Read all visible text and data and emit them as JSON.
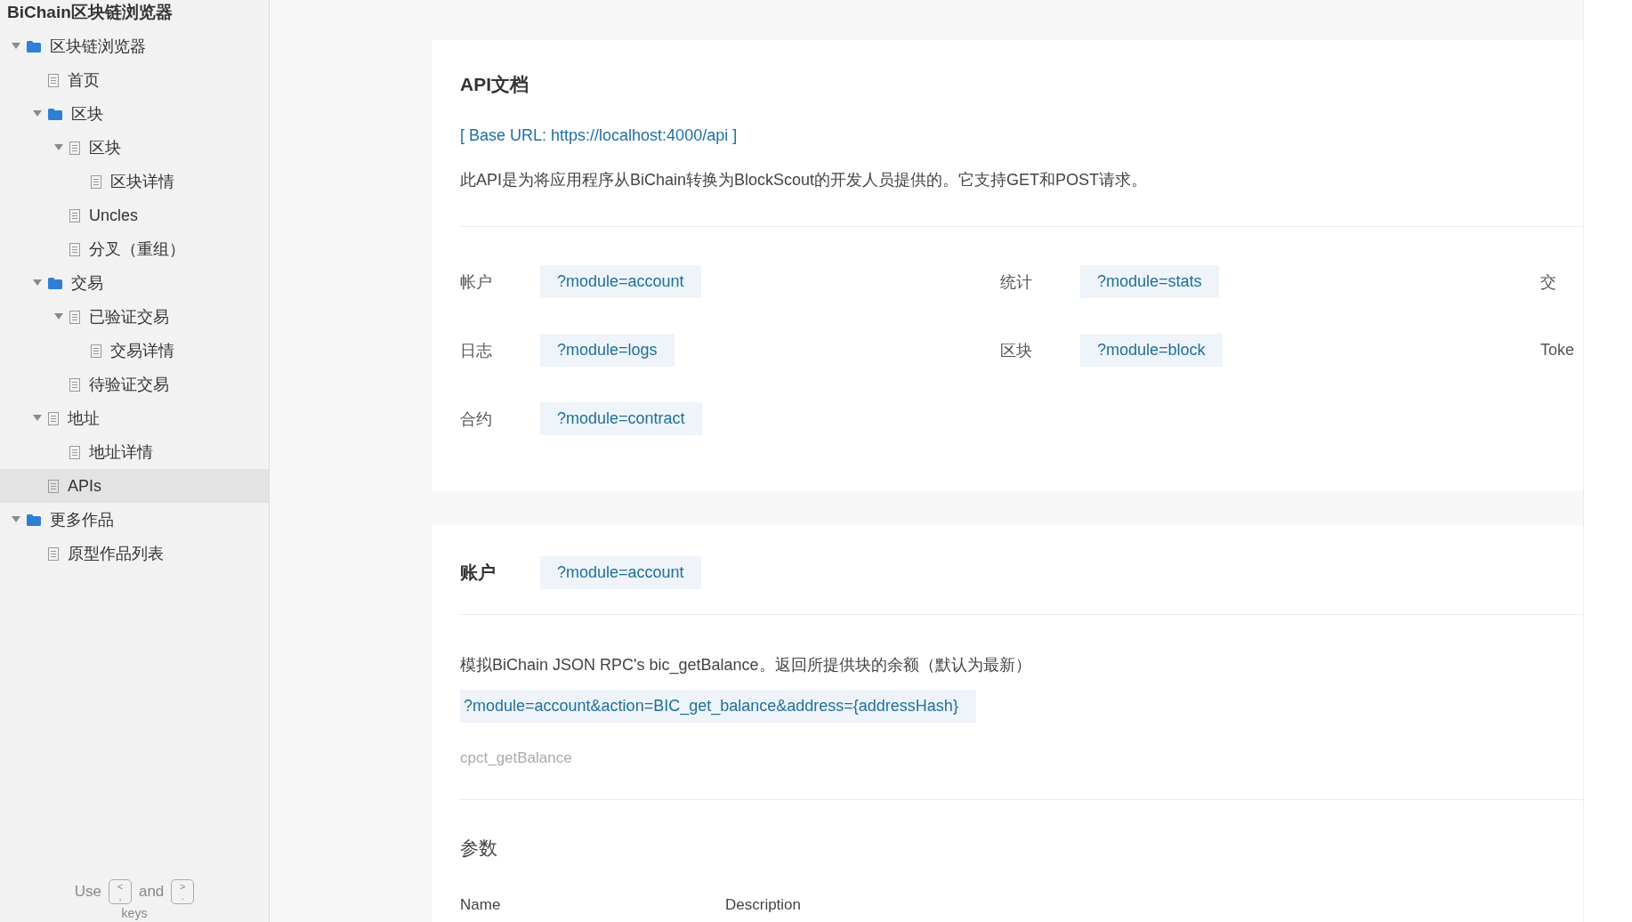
{
  "sidebar": {
    "title": "BiChain区块链浏览器",
    "tree": [
      {
        "label": "区块链浏览器",
        "kind": "folder",
        "expanded": true,
        "selected": false,
        "children": [
          {
            "label": "首页",
            "kind": "page",
            "expanded": false,
            "selected": false
          },
          {
            "label": "区块",
            "kind": "folder",
            "expanded": true,
            "selected": false,
            "children": [
              {
                "label": "区块",
                "kind": "page",
                "expanded": true,
                "selected": false,
                "children": [
                  {
                    "label": "区块详情",
                    "kind": "page",
                    "expanded": false,
                    "selected": false
                  }
                ]
              },
              {
                "label": "Uncles",
                "kind": "page",
                "expanded": false,
                "selected": false
              },
              {
                "label": "分叉（重组）",
                "kind": "page",
                "expanded": false,
                "selected": false
              }
            ]
          },
          {
            "label": "交易",
            "kind": "folder",
            "expanded": true,
            "selected": false,
            "children": [
              {
                "label": "已验证交易",
                "kind": "page",
                "expanded": true,
                "selected": false,
                "children": [
                  {
                    "label": "交易详情",
                    "kind": "page",
                    "expanded": false,
                    "selected": false
                  }
                ]
              },
              {
                "label": "待验证交易",
                "kind": "page",
                "expanded": false,
                "selected": false
              }
            ]
          },
          {
            "label": "地址",
            "kind": "page",
            "expanded": true,
            "selected": false,
            "children": [
              {
                "label": "地址详情",
                "kind": "page",
                "expanded": false,
                "selected": false
              }
            ]
          },
          {
            "label": "APIs",
            "kind": "page",
            "expanded": false,
            "selected": true
          }
        ]
      },
      {
        "label": "更多作品",
        "kind": "folder",
        "expanded": true,
        "selected": false,
        "children": [
          {
            "label": "原型作品列表",
            "kind": "page",
            "expanded": false,
            "selected": false
          }
        ]
      }
    ],
    "hint": {
      "before": "Use",
      "key1": {
        "top": "<",
        "bottom": ","
      },
      "middle": "and",
      "key2": {
        "top": ">",
        "bottom": "."
      },
      "after": "keys"
    }
  },
  "api_doc": {
    "title": "API文档",
    "base_url": "[ Base URL: https://localhost:4000/api ]",
    "description": "此API是为将应用程序从BiChain转换为BlockScout的开发人员提供的。它支持GET和POST请求。",
    "module_rows": [
      {
        "cells": [
          {
            "label": "帐户",
            "code": "?module=account"
          },
          {
            "label": "统计",
            "code": "?module=stats"
          },
          {
            "label": "交"
          }
        ]
      },
      {
        "cells": [
          {
            "label": "日志",
            "code": "?module=logs"
          },
          {
            "label": "区块",
            "code": "?module=block"
          },
          {
            "label": "Toke"
          }
        ]
      },
      {
        "cells": [
          {
            "label": "合约",
            "code": "?module=contract"
          }
        ]
      }
    ]
  },
  "account_section": {
    "title": "账户",
    "code": "?module=account",
    "endpoint": {
      "description": "模拟BiChain JSON RPC's bic_getBalance。返回所提供块的余额（默认为最新）",
      "url": "?module=account&action=BIC_get_balance&address={addressHash}",
      "alias": "cpct_getBalance"
    },
    "params": {
      "title": "参数",
      "columns": [
        "Name",
        "Description"
      ]
    }
  }
}
